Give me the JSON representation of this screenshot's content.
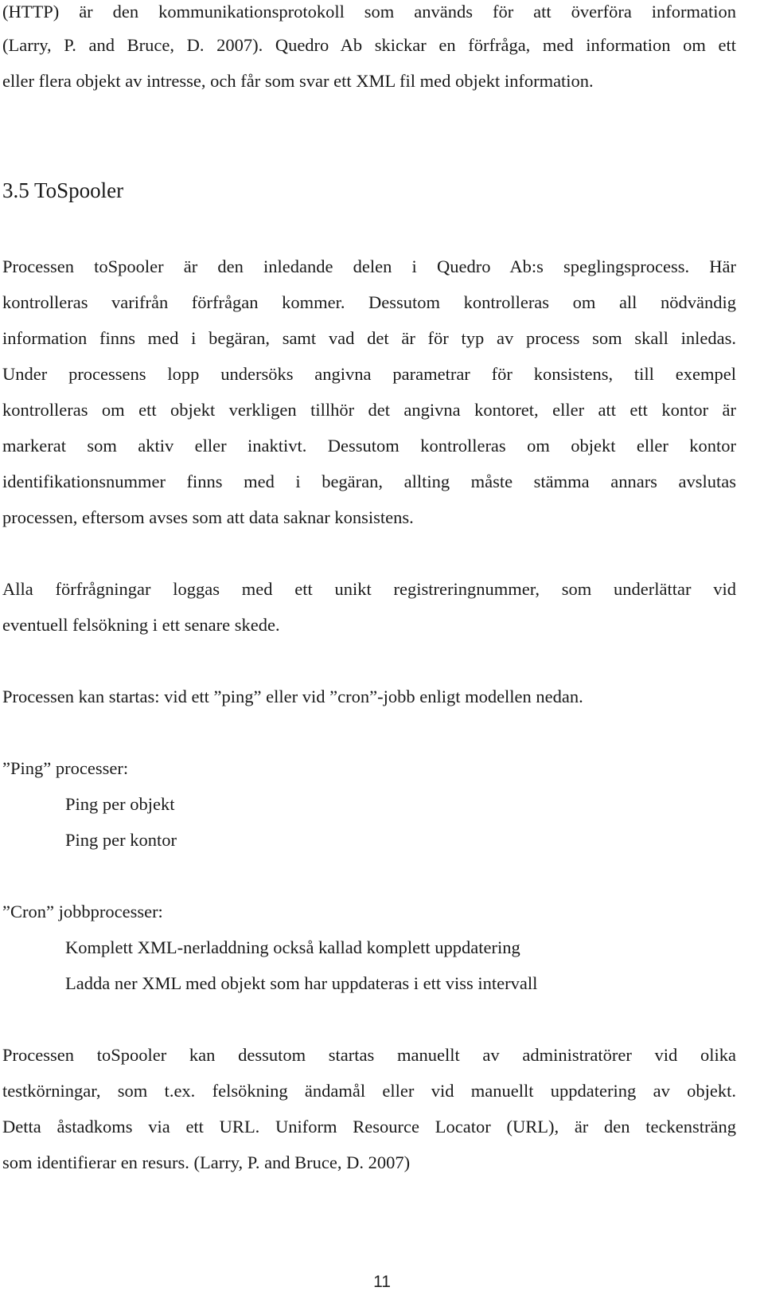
{
  "document": {
    "intro_paragraph": {
      "lines": [
        "(HTTP) är den kommunikationsprotokoll som används för att överföra information",
        "(Larry, P. and Bruce, D. 2007). Quedro Ab skickar en förfråga, med information om ett",
        "eller flera objekt av intresse, och får som svar ett XML fil med objekt information."
      ]
    },
    "section_heading": "3.5  ToSpooler",
    "paragraph_1": {
      "lines": [
        "Processen toSpooler är den inledande delen i Quedro Ab:s speglingsprocess. Här",
        "kontrolleras varifrån förfrågan kommer. Dessutom kontrolleras om all nödvändig",
        "information finns med i begäran, samt vad det är för typ av process som skall inledas.",
        "Under processens lopp undersöks angivna parametrar för konsistens, till exempel",
        "kontrolleras om ett objekt verkligen tillhör det angivna kontoret, eller att ett kontor är",
        "markerat som aktiv eller inaktivt. Dessutom kontrolleras om objekt eller kontor",
        "identifikationsnummer finns med i begäran, allting måste stämma annars avslutas",
        "processen, eftersom avses som att data saknar konsistens."
      ]
    },
    "paragraph_2": {
      "lines": [
        "Alla förfrågningar loggas med ett unikt registreringnummer, som underlättar vid",
        "eventuell felsökning i ett senare skede."
      ]
    },
    "paragraph_3": "Processen kan startas: vid ett ”ping” eller vid ”cron”-jobb enligt modellen nedan.",
    "ping_list": {
      "title": "”Ping” processer:",
      "items": [
        "Ping per objekt",
        "Ping per kontor"
      ]
    },
    "cron_list": {
      "title": "”Cron” jobbprocesser:",
      "items": [
        "Komplett XML-nerladdning också kallad komplett uppdatering",
        "Ladda ner XML med objekt som har uppdateras i ett viss intervall"
      ]
    },
    "paragraph_4": {
      "lines": [
        "Processen toSpooler kan dessutom startas manuellt av administratörer vid olika",
        "testkörningar, som t.ex. felsökning ändamål eller vid manuellt uppdatering av objekt.",
        "Detta åstadkoms via ett URL. Uniform Resource Locator (URL), är den teckensträng",
        "som identifierar en resurs. (Larry, P. and Bruce, D. 2007)"
      ]
    },
    "page_number": "11"
  }
}
